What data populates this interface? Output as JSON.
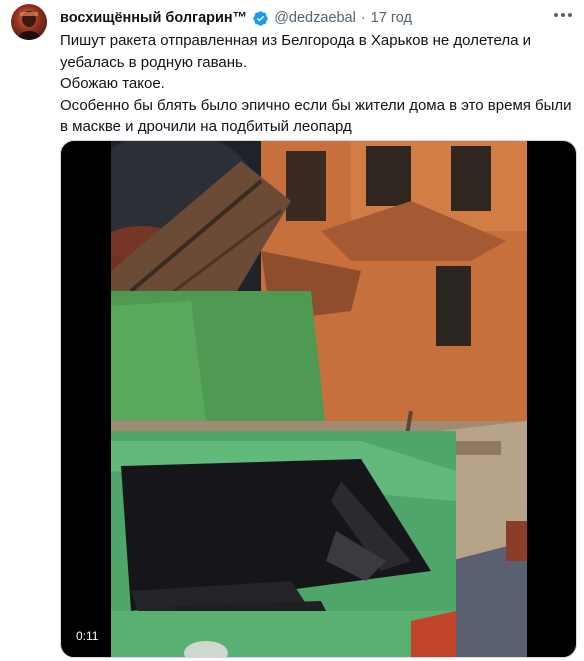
{
  "author": {
    "display_name": "восхищённый болгарин™",
    "handle": "@dedzaebal",
    "separator": "·",
    "time": "17 год",
    "avatar_icon": "avatar-icon",
    "verified_icon": "verified-badge-icon",
    "verified_color": "#1d9bf0"
  },
  "tweet": {
    "lines": [
      "Пишут ракета отправленная из Белгорода в Харьков не долетела и уебалась в родную гавань.",
      "Обожаю такое.",
      "Особенно бы блять было эпично если бы жители дома в это время были в маскве и дрочили на подбитый леопард"
    ]
  },
  "media": {
    "type": "video",
    "duration": "0:11"
  },
  "colors": {
    "text": "#0f1419",
    "secondary": "#536471",
    "border": "#cfd9de"
  }
}
